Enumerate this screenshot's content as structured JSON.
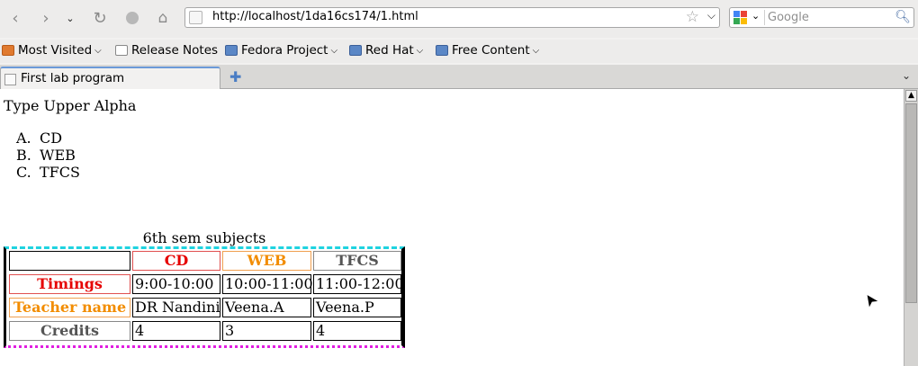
{
  "toolbar": {
    "url": "http://localhost/1da16cs174/1.html",
    "search_placeholder": "Google"
  },
  "bookmarks": [
    {
      "label": "Most Visited",
      "icon": "rss-icon",
      "dropdown": true
    },
    {
      "label": "Release Notes",
      "icon": "page-icon",
      "dropdown": false
    },
    {
      "label": "Fedora Project",
      "icon": "folder-icon",
      "dropdown": true
    },
    {
      "label": "Red Hat",
      "icon": "folder-icon",
      "dropdown": true
    },
    {
      "label": "Free Content",
      "icon": "folder-icon",
      "dropdown": true
    }
  ],
  "tab": {
    "title": "First lab program"
  },
  "page": {
    "heading": "Type Upper Alpha",
    "list": [
      {
        "marker": "A.",
        "text": "CD"
      },
      {
        "marker": "B.",
        "text": "WEB"
      },
      {
        "marker": "C.",
        "text": "TFCS"
      }
    ],
    "table": {
      "caption": "6th sem subjects",
      "header": [
        "",
        "CD",
        "WEB",
        "TFCS"
      ],
      "rows": [
        {
          "label": "Timings",
          "cells": [
            "9:00-10:00",
            "10:00-11:00",
            "11:00-12:00"
          ]
        },
        {
          "label": "Teacher name",
          "cells": [
            "DR Nandini",
            "Veena.A",
            "Veena.P"
          ]
        },
        {
          "label": "Credits",
          "cells": [
            "4",
            "3",
            "4"
          ]
        }
      ]
    }
  },
  "colors": {
    "red": "#e60000",
    "orange": "#f28c00",
    "grey": "#555555",
    "dashed_top": "#1fd3e0",
    "dotted_bottom": "#e11ee1"
  }
}
